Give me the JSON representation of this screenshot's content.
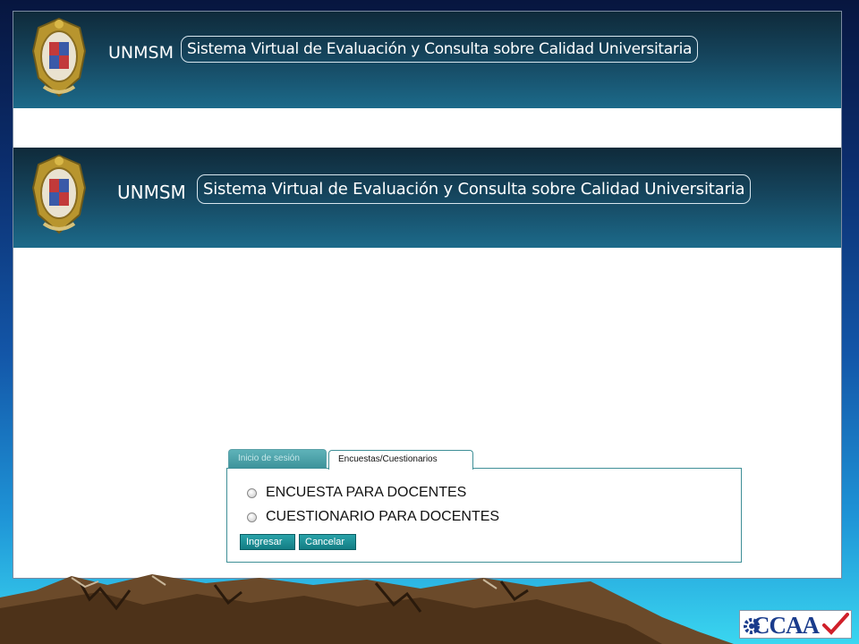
{
  "banner": {
    "brand": "UNMSM",
    "system_title": "Sistema Virtual de Evaluación y Consulta sobre Calidad Universitaria",
    "crest_icon": "university-crest-icon"
  },
  "tabs": [
    {
      "label": "Inicio de sesión",
      "active": false
    },
    {
      "label": "Encuestas/Cuestionarios",
      "active": true
    }
  ],
  "options": [
    {
      "label": "ENCUESTA PARA DOCENTES",
      "selected": false
    },
    {
      "label": "CUESTIONARIO PARA DOCENTES",
      "selected": false
    }
  ],
  "buttons": {
    "submit": "Ingresar",
    "cancel": "Cancelar"
  },
  "footer_logo": {
    "text": "CCAA",
    "icon": "checkmark-icon"
  },
  "colors": {
    "banner_top": "#0f2a3a",
    "banner_bottom": "#1c6a8a",
    "tab_teal": "#3d939b",
    "button_teal": "#1a8f96",
    "logo_blue": "#1a3c8c",
    "check_red": "#d0202a"
  }
}
